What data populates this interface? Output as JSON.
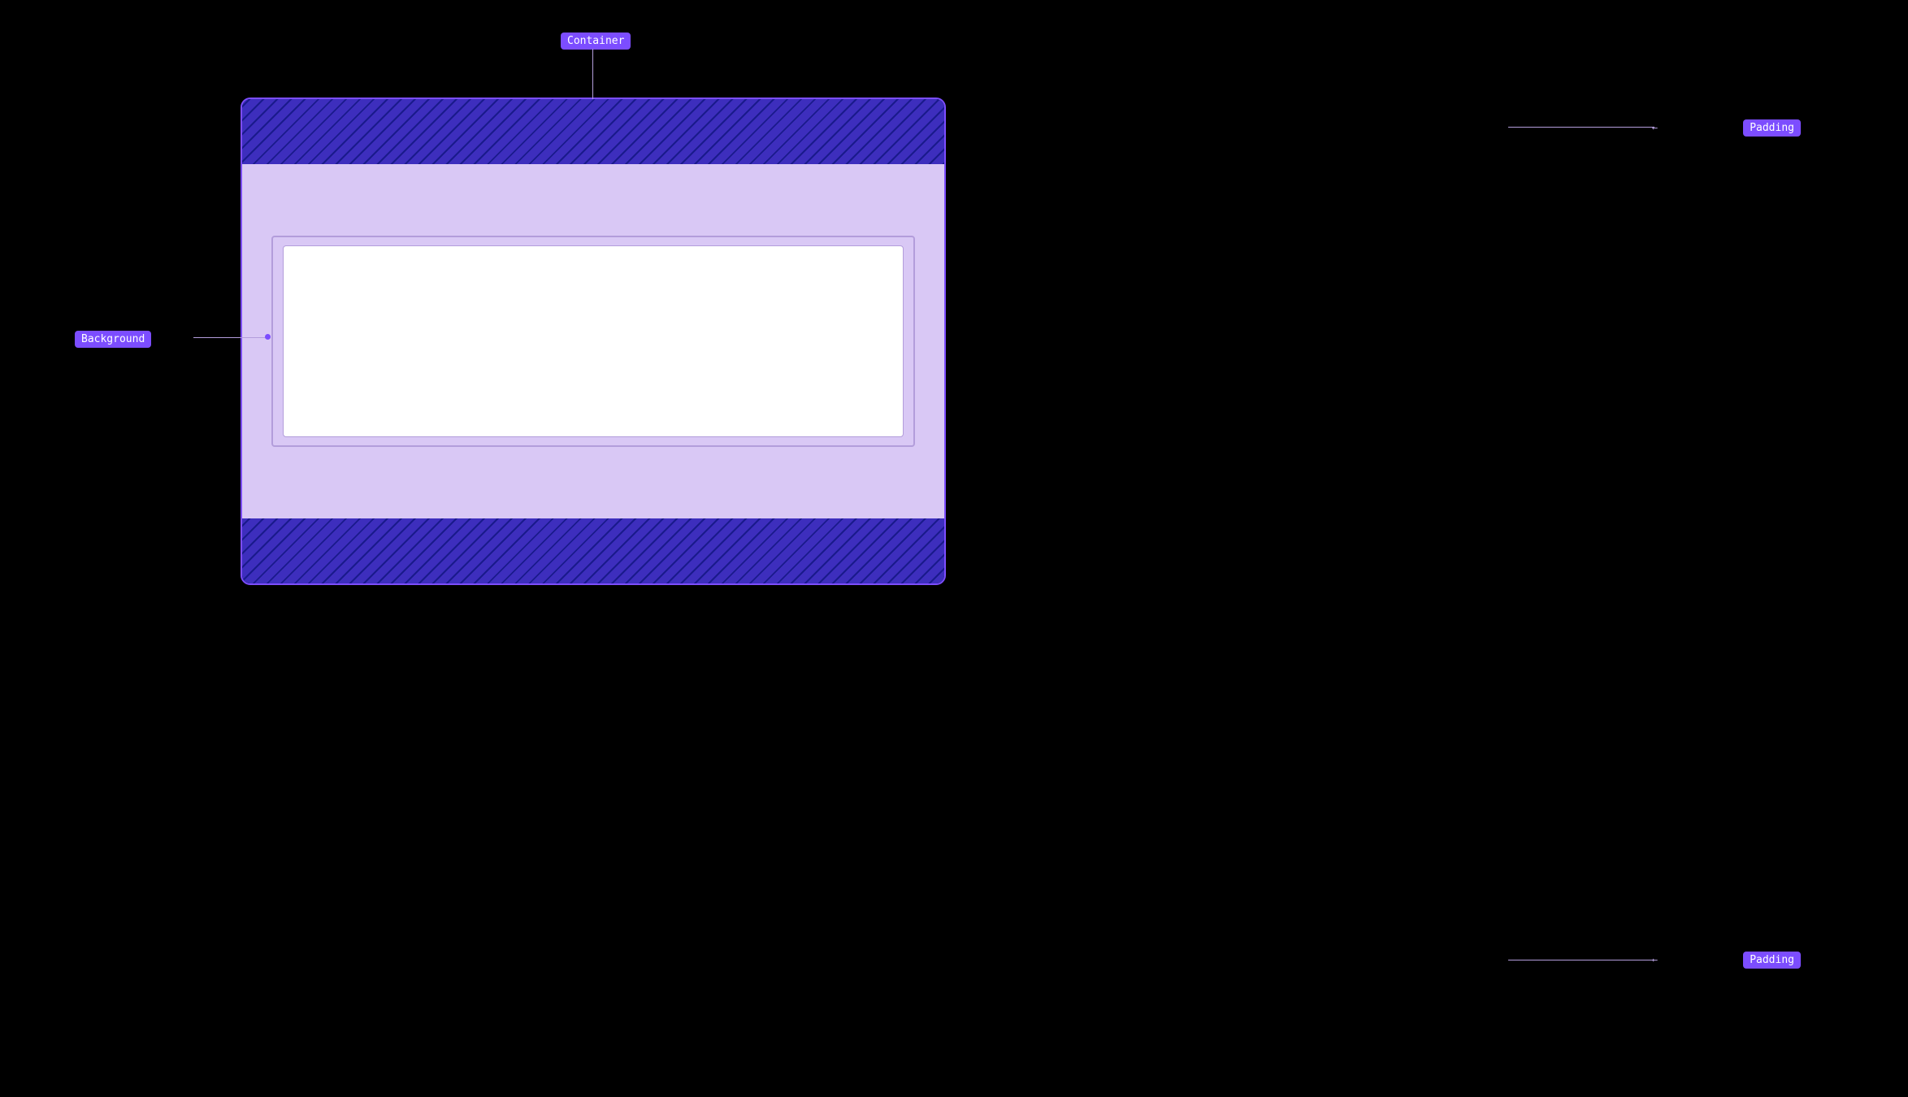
{
  "labels": {
    "container": "Container",
    "background": "Background",
    "padding_top": "Padding",
    "padding_bottom": "Padding"
  },
  "colors": {
    "page_bg": "#000000",
    "label_bg": "#7c4dff",
    "label_text": "#ffffff",
    "container_border": "#7c4dff",
    "background_fill": "#d9c8f5",
    "content_fill": "#ffffff",
    "inner_border": "#b39ddb",
    "hatch_dark": "#1a1a8c",
    "hatch_light": "#3d2ebd",
    "line_color": "#b39ddb"
  }
}
